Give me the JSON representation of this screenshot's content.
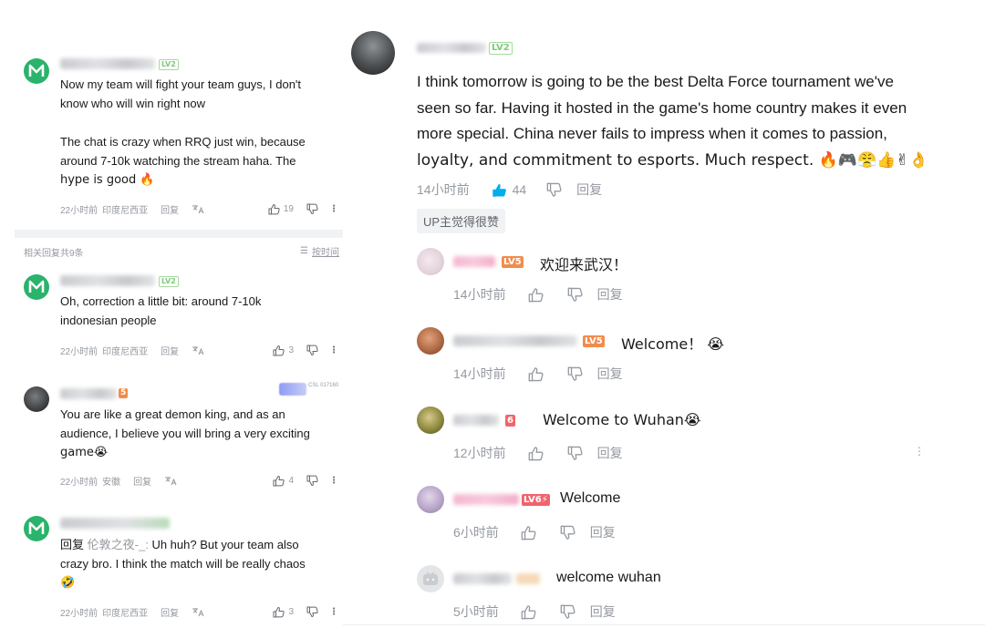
{
  "left": {
    "main_comment": {
      "level": "LV2",
      "lines": [
        "Now my team will fight your team guys, I don't",
        "know who will win right now",
        "",
        "The chat is crazy when RRQ just win, because",
        "around 7-10k watching the stream haha. The",
        "hype is good 🔥"
      ],
      "time": "22小时前",
      "location": "印度尼西亚",
      "reply_label": "回复",
      "likes": "19"
    },
    "replies_header": "相关回复共9条",
    "sort_label": "按时间",
    "replies": [
      {
        "level": "LV2",
        "lines": [
          "Oh, correction a little bit: around 7-10k",
          "indonesian people"
        ],
        "time": "22小时前",
        "location": "印度尼西亚",
        "reply_label": "回复",
        "likes": "3"
      },
      {
        "level": "5",
        "lines": [
          "You are like a great demon king, and as an",
          "audience, I believe you will bring a very exciting",
          "game😭"
        ],
        "time": "22小时前",
        "location": "安徽",
        "reply_label": "回复",
        "likes": "4",
        "badge_text": "CSL 017160"
      },
      {
        "level": "",
        "reply_prefix": "回复",
        "reply_target": "伦敦之夜-_:",
        "lines": [
          "Uh huh? But your team also",
          "crazy bro. I think the match will be really chaos",
          "🤣"
        ],
        "time": "22小时前",
        "location": "印度尼西亚",
        "reply_label": "回复",
        "likes": "3"
      }
    ]
  },
  "right": {
    "main_comment": {
      "level": "LV2",
      "lines": [
        "I think tomorrow is going to be the best Delta Force tournament we've",
        "seen so far. Having it hosted in the game's home country makes it even",
        "more special. China never fails to impress when it comes to passion,",
        "loyalty, and commitment to esports. Much respect. 🔥🎮😤👍✌👌"
      ],
      "time": "14小时前",
      "likes": "44",
      "reply_label": "回复",
      "up_badge": "UP主觉得很赞"
    },
    "replies": [
      {
        "level": "LV5",
        "text": "欢迎来武汉！",
        "time": "14小时前",
        "reply_label": "回复"
      },
      {
        "level": "LV5",
        "text": "Welcome！ 😭",
        "time": "14小时前",
        "reply_label": "回复"
      },
      {
        "level": "6",
        "text": "Welcome to Wuhan😭",
        "time": "12小时前",
        "reply_label": "回复"
      },
      {
        "level": "LV6⚡",
        "text": "Welcome",
        "time": "6小时前",
        "reply_label": "回复"
      },
      {
        "level": "",
        "text": "welcome wuhan",
        "time": "5小时前",
        "reply_label": "回复"
      }
    ]
  },
  "colors": {
    "primary_text": "#18191c",
    "meta_text": "#9499a0",
    "like_active": "#00aeec",
    "avatar_green": "#29b36b"
  }
}
